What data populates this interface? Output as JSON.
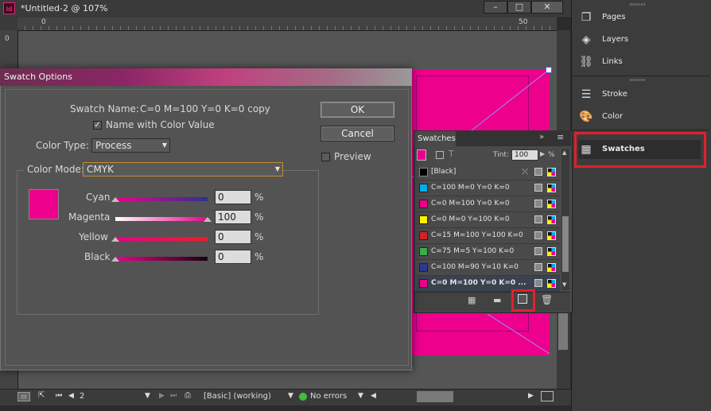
{
  "window": {
    "doc_title": "*Untitled-2 @ 107%",
    "app_icon_text": "Id",
    "btn_minimize": "–",
    "btn_restore": "□",
    "btn_close": "✕"
  },
  "ruler": {
    "zero_label": "0",
    "fifty_label": "50",
    "left_zero": "0"
  },
  "status": {
    "page_number": "2",
    "style": "[Basic] (working)",
    "errors": "No errors"
  },
  "dock": {
    "items": [
      {
        "label": "Pages",
        "icon": "pages-icon"
      },
      {
        "label": "Layers",
        "icon": "layers-icon"
      },
      {
        "label": "Links",
        "icon": "links-icon"
      },
      {
        "label": "Stroke",
        "icon": "stroke-icon"
      },
      {
        "label": "Color",
        "icon": "color-palette-icon"
      },
      {
        "label": "Swatches",
        "icon": "swatches-grid-icon",
        "highlighted": true
      }
    ]
  },
  "swatches": {
    "tab": "Swatches",
    "tint_label": "Tint:",
    "tint_value": "100",
    "tint_unit": "%",
    "items": [
      {
        "name": "[Black]",
        "color": "#000000"
      },
      {
        "name": "C=100 M=0 Y=0 K=0",
        "color": "#00aeef"
      },
      {
        "name": "C=0 M=100 Y=0 K=0",
        "color": "#ec008c"
      },
      {
        "name": "C=0 M=0 Y=100 K=0",
        "color": "#fff200"
      },
      {
        "name": "C=15 M=100 Y=100 K=0",
        "color": "#d2232a"
      },
      {
        "name": "C=75 M=5 Y=100 K=0",
        "color": "#3aae49"
      },
      {
        "name": "C=100 M=90 Y=10 K=0",
        "color": "#2b3990"
      },
      {
        "name": "C=0 M=100 Y=0 K=0 ...",
        "color": "#ec008c",
        "selected": true
      }
    ]
  },
  "dialog": {
    "title": "Swatch Options",
    "swatch_name_label": "Swatch Name:",
    "swatch_name_value": "C=0 M=100 Y=0 K=0 copy",
    "name_with_color_value": "Name with Color Value",
    "name_with_color_checked": true,
    "color_type_label": "Color Type:",
    "color_type_value": "Process",
    "color_mode_label": "Color Mode:",
    "color_mode_value": "CMYK",
    "preview_label": "Preview",
    "ok_label": "OK",
    "cancel_label": "Cancel",
    "preview_color": "#ec008c",
    "channels": [
      {
        "label": "Cyan",
        "value": "0",
        "unit": "%",
        "level": 0,
        "gradient": [
          "#ec008c",
          "#2e3192"
        ]
      },
      {
        "label": "Magenta",
        "value": "100",
        "unit": "%",
        "level": 1,
        "gradient": [
          "#ffffff",
          "#ec008c"
        ]
      },
      {
        "label": "Yellow",
        "value": "0",
        "unit": "%",
        "level": 0,
        "gradient": [
          "#ec008c",
          "#ed1c24"
        ]
      },
      {
        "label": "Black",
        "value": "0",
        "unit": "%",
        "level": 0,
        "gradient": [
          "#ec008c",
          "#1a0010"
        ]
      }
    ]
  },
  "colors": {
    "accent_red": "#e0202f",
    "magenta": "#ec008c"
  }
}
